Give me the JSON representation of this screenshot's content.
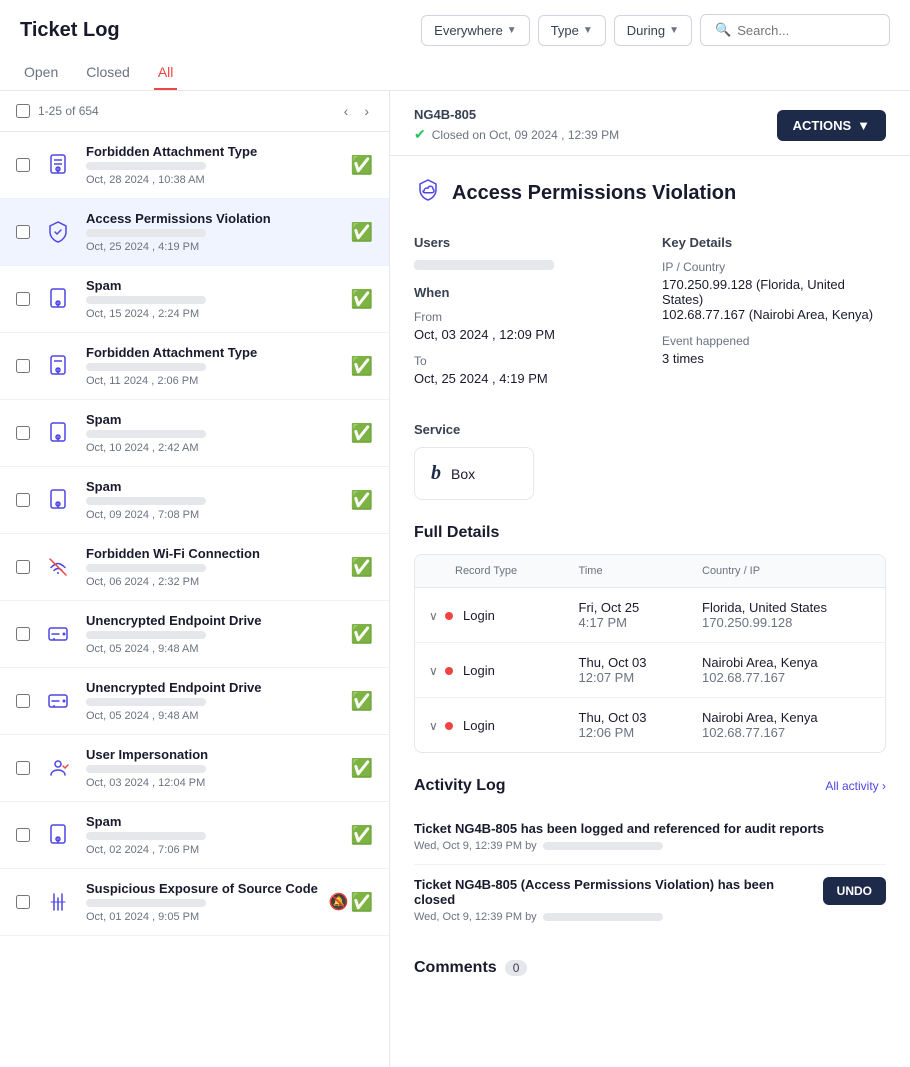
{
  "header": {
    "title": "Ticket Log",
    "tabs": [
      {
        "label": "Open",
        "active": false
      },
      {
        "label": "Closed",
        "active": false
      },
      {
        "label": "All",
        "active": true
      }
    ],
    "filter_everywhere": "Everywhere",
    "filter_type": "Type",
    "filter_during": "During",
    "search_placeholder": "Search..."
  },
  "list": {
    "count": "1-25 of 654",
    "tickets": [
      {
        "name": "Forbidden Attachment Type",
        "date": "Oct, 28 2024 , 10:38 AM",
        "status": "check",
        "icon": "attachment"
      },
      {
        "name": "Access Permissions Violation",
        "date": "Oct, 25 2024 , 4:19 PM",
        "status": "check",
        "icon": "shield",
        "selected": true
      },
      {
        "name": "Spam",
        "date": "Oct, 15 2024 , 2:24 PM",
        "status": "check",
        "icon": "attachment"
      },
      {
        "name": "Forbidden Attachment Type",
        "date": "Oct, 11 2024 , 2:06 PM",
        "status": "check",
        "icon": "attachment"
      },
      {
        "name": "Spam",
        "date": "Oct, 10 2024 , 2:42 AM",
        "status": "check",
        "icon": "attachment"
      },
      {
        "name": "Spam",
        "date": "Oct, 09 2024 , 7:08 PM",
        "status": "check",
        "icon": "attachment"
      },
      {
        "name": "Forbidden Wi-Fi Connection",
        "date": "Oct, 06 2024 , 2:32 PM",
        "status": "check",
        "icon": "wifi"
      },
      {
        "name": "Unencrypted Endpoint Drive",
        "date": "Oct, 05 2024 , 9:48 AM",
        "status": "check",
        "icon": "drive"
      },
      {
        "name": "Unencrypted Endpoint Drive",
        "date": "Oct, 05 2024 , 9:48 AM",
        "status": "check",
        "icon": "drive"
      },
      {
        "name": "User Impersonation",
        "date": "Oct, 03 2024 , 12:04 PM",
        "status": "check",
        "icon": "user"
      },
      {
        "name": "Spam",
        "date": "Oct, 02 2024 , 7:06 PM",
        "status": "check",
        "icon": "attachment"
      },
      {
        "name": "Suspicious Exposure of Source Code",
        "date": "Oct, 01 2024 , 9:05 PM",
        "status": "multi",
        "icon": "code"
      }
    ]
  },
  "detail": {
    "ticket_id": "NG4B-805",
    "closed_text": "Closed on Oct, 09 2024 , 12:39 PM",
    "actions_label": "ACTIONS",
    "title": "Access Permissions Violation",
    "sections": {
      "users_label": "Users",
      "when_label": "When",
      "from_label": "From",
      "from_value": "Oct, 03 2024 , 12:09 PM",
      "to_label": "To",
      "to_value": "Oct, 25 2024 , 4:19 PM",
      "key_details_label": "Key Details",
      "ip_country_label": "IP / Country",
      "ip_values": "170.250.99.128 (Florida, United States)\n102.68.77.167 (Nairobi Area, Kenya)",
      "event_happened_label": "Event happened",
      "event_count": "3 times"
    },
    "service": {
      "label": "Service",
      "name": "Box"
    },
    "full_details": {
      "title": "Full Details",
      "columns": [
        "Record Type",
        "Time",
        "Country / IP"
      ],
      "rows": [
        {
          "record": "Login",
          "time": "Fri, Oct 25\n4:17 PM",
          "location": "Florida, United States\n170.250.99.128"
        },
        {
          "record": "Login",
          "time": "Thu, Oct 03\n12:07 PM",
          "location": "Nairobi Area, Kenya\n102.68.77.167"
        },
        {
          "record": "Login",
          "time": "Thu, Oct 03\n12:06 PM",
          "location": "Nairobi Area, Kenya\n102.68.77.167"
        }
      ]
    },
    "activity": {
      "title": "Activity Log",
      "all_label": "All activity ›",
      "items": [
        {
          "text": "Ticket NG4B-805 has been logged and referenced for audit reports",
          "date": "Wed, Oct 9, 12:39 PM by",
          "has_undo": false
        },
        {
          "text": "Ticket NG4B-805 (Access Permissions Violation) has been closed",
          "date": "Wed, Oct 9, 12:39 PM by",
          "has_undo": true,
          "undo_label": "UNDO"
        }
      ]
    },
    "comments": {
      "title": "Comments",
      "count": "0"
    }
  }
}
